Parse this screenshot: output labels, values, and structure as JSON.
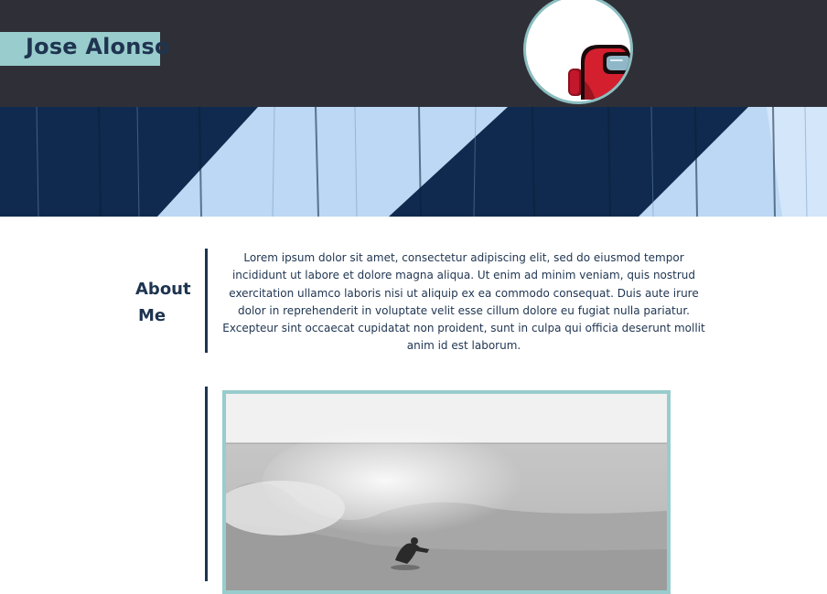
{
  "header": {
    "name": "Jose Alonso",
    "colors": {
      "background": "#2f3037",
      "name_box": "#99cccc",
      "name_text": "#1e3450"
    },
    "avatar": {
      "icon": "crewmate-avatar-icon"
    }
  },
  "banner": {
    "icon": "striped-wood-banner"
  },
  "about": {
    "title_line1": "About",
    "title_line2": "Me",
    "text": "Lorem ipsum dolor sit amet, consectetur adipiscing elit, sed do eiusmod tempor incididunt ut labore et dolore magna aliqua. Ut enim ad minim veniam, quis nostrud exercitation ullamco laboris nisi ut aliquip ex ea commodo consequat. Duis aute irure dolor in reprehenderit in voluptate velit esse cillum dolore eu fugiat nulla pariatur. Excepteur sint occaecat cupidatat non proident, sunt in culpa qui officia deserunt mollit anim id est laborum."
  },
  "photo": {
    "icon": "surfer-wave-photo"
  }
}
